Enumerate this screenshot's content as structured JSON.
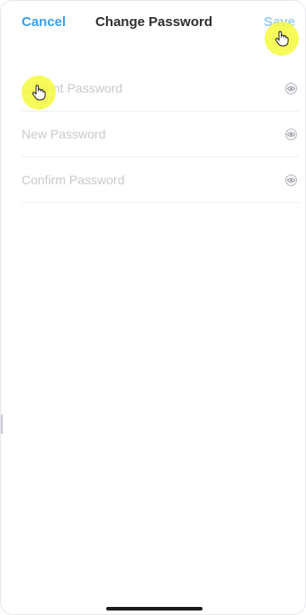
{
  "nav": {
    "cancel_label": "Cancel",
    "title": "Change Password",
    "save_label": "Save"
  },
  "fields": [
    {
      "placeholder": "Current Password",
      "value": "",
      "visibility_icon": "eye-icon"
    },
    {
      "placeholder": "New Password",
      "value": "",
      "visibility_icon": "eye-icon"
    },
    {
      "placeholder": "Confirm Password",
      "value": "",
      "visibility_icon": "eye-icon"
    }
  ],
  "overlays": {
    "touch_indicator_icon": "hand-pointer-icon",
    "touch_color": "#f6fa3c"
  },
  "colors": {
    "accent": "#3aa0e6",
    "accent_disabled": "#9ccdf2",
    "title": "#2e2e33",
    "placeholder": "#c9c9cf",
    "divider": "#efeff2"
  }
}
